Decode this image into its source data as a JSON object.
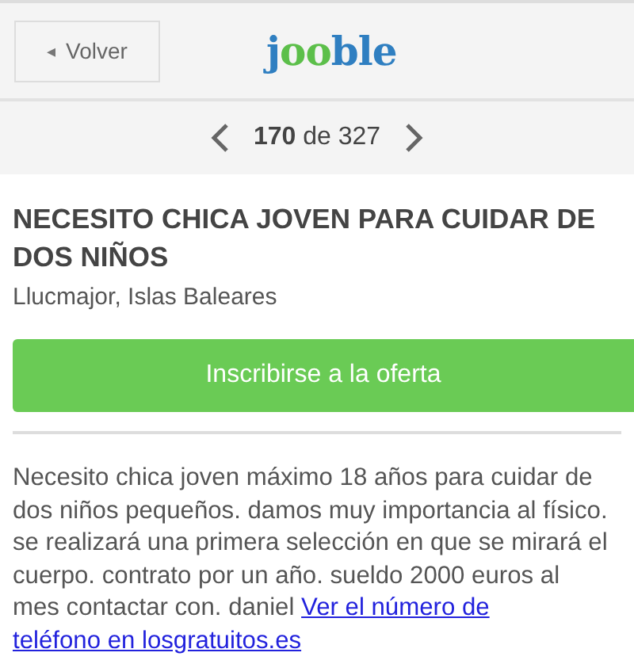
{
  "header": {
    "back_button": {
      "icon": "◂",
      "label": "Volver"
    },
    "logo": [
      {
        "text": "j",
        "color": "#2f7fc1"
      },
      {
        "text": "oo",
        "color": "#5cbf4a"
      },
      {
        "text": "ble",
        "color": "#2f7fc1"
      }
    ]
  },
  "pager": {
    "text": "**170** de 327"
  },
  "job": {
    "title": "NECESITO CHICA JOVEN PARA CUIDAR DE DOS NIÑOS",
    "location": "Llucmajor, Islas Baleares",
    "apply_button": "Inscribirse a la oferta",
    "description": "Necesito chica joven máximo 18 años para cuidar de dos niños pequeños. damos muy importancia al físico. se realizará una primera selección en que se mirará el cuerpo. contrato por un año. sueldo 2000 euros al mes contactar con. daniel",
    "link_lines": [
      "Ver el número de",
      "teléfono en losgratuitos.es"
    ]
  }
}
